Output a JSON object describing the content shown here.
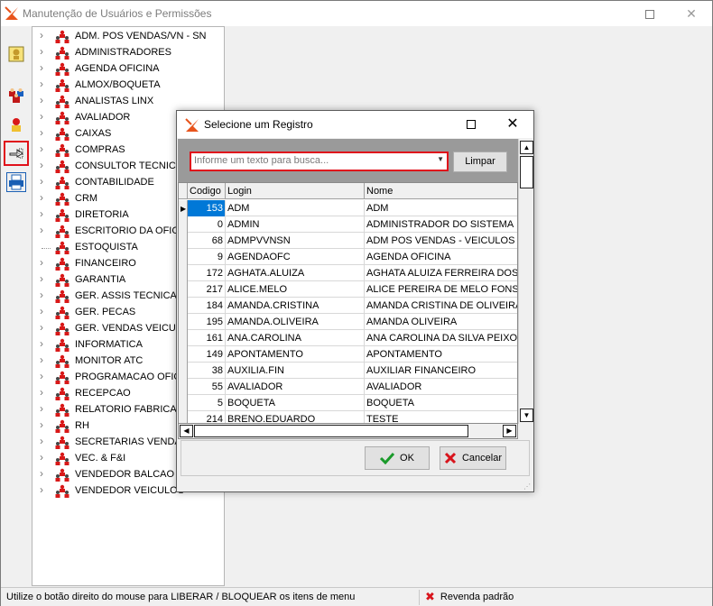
{
  "window": {
    "title": "Manutenção de Usuários e Permissões",
    "maximize_glyph": "",
    "close_glyph": "✕"
  },
  "toolbar": {
    "buttons": [
      {
        "name": "key-user-icon"
      },
      {
        "name": "group-users-icon"
      },
      {
        "name": "user-lock-icon"
      },
      {
        "name": "hand-pointer-icon"
      },
      {
        "name": "print-icon"
      }
    ]
  },
  "tree": {
    "items": [
      {
        "label": "ADM. POS VENDAS/VN - SN",
        "expandable": true
      },
      {
        "label": "ADMINISTRADORES",
        "expandable": true
      },
      {
        "label": "AGENDA OFICINA",
        "expandable": true
      },
      {
        "label": "ALMOX/BOQUETA",
        "expandable": true
      },
      {
        "label": "ANALISTAS LINX",
        "expandable": true
      },
      {
        "label": "AVALIADOR",
        "expandable": true
      },
      {
        "label": "CAIXAS",
        "expandable": true
      },
      {
        "label": "COMPRAS",
        "expandable": true
      },
      {
        "label": "CONSULTOR TECNICO",
        "expandable": true
      },
      {
        "label": "CONTABILIDADE",
        "expandable": true
      },
      {
        "label": "CRM",
        "expandable": true
      },
      {
        "label": "DIRETORIA",
        "expandable": true
      },
      {
        "label": "ESCRITORIO DA OFICIN",
        "expandable": true
      },
      {
        "label": "ESTOQUISTA",
        "expandable": false
      },
      {
        "label": "FINANCEIRO",
        "expandable": true
      },
      {
        "label": "GARANTIA",
        "expandable": true
      },
      {
        "label": "GER. ASSIS TECNICA",
        "expandable": true
      },
      {
        "label": "GER. PECAS",
        "expandable": true
      },
      {
        "label": "GER. VENDAS VEICULOS",
        "expandable": true
      },
      {
        "label": "INFORMATICA",
        "expandable": true
      },
      {
        "label": "MONITOR ATC",
        "expandable": true
      },
      {
        "label": "PROGRAMACAO OFICIN",
        "expandable": true
      },
      {
        "label": "RECEPCAO",
        "expandable": true
      },
      {
        "label": "RELATORIO FABRICA",
        "expandable": true
      },
      {
        "label": "RH",
        "expandable": true
      },
      {
        "label": "SECRETARIAS VENDAS",
        "expandable": true
      },
      {
        "label": "VEC. & F&I",
        "expandable": true
      },
      {
        "label": "VENDEDOR BALCAO PC",
        "expandable": true
      },
      {
        "label": "VENDEDOR VEICULOS",
        "expandable": true
      }
    ]
  },
  "status": {
    "left_text": "Utilize o botão direito do mouse para LIBERAR / BLOQUEAR os itens de menu",
    "right_text": "Revenda padrão",
    "right_icon": "red-x-icon"
  },
  "dialog": {
    "title": "Selecione um Registro",
    "search": {
      "placeholder": "Informe um texto para busca..."
    },
    "clear_label": "Limpar",
    "ok_label": "OK",
    "cancel_label": "Cancelar",
    "columns": [
      "Codigo",
      "Login",
      "Nome"
    ],
    "rows": [
      {
        "codigo": "153",
        "login": "ADM",
        "nome": "ADM",
        "selected": true
      },
      {
        "codigo": "0",
        "login": "ADMIN",
        "nome": "ADMINISTRADOR DO SISTEMA"
      },
      {
        "codigo": "68",
        "login": "ADMPVVNSN",
        "nome": "ADM POS VENDAS - VEICULOS NOV"
      },
      {
        "codigo": "9",
        "login": "AGENDAOFC",
        "nome": "AGENDA OFICINA"
      },
      {
        "codigo": "172",
        "login": "AGHATA.ALUIZA",
        "nome": "AGHATA ALUIZA FERREIRA DOS SA"
      },
      {
        "codigo": "217",
        "login": "ALICE.MELO",
        "nome": "ALICE PEREIRA DE MELO FONSECA"
      },
      {
        "codigo": "184",
        "login": "AMANDA.CRISTINA",
        "nome": "AMANDA CRISTINA DE OLIVEIRA"
      },
      {
        "codigo": "195",
        "login": "AMANDA.OLIVEIRA",
        "nome": "AMANDA OLIVEIRA"
      },
      {
        "codigo": "161",
        "login": "ANA.CAROLINA",
        "nome": "ANA CAROLINA DA SILVA PEIXOTO"
      },
      {
        "codigo": "149",
        "login": "APONTAMENTO",
        "nome": "APONTAMENTO"
      },
      {
        "codigo": "38",
        "login": "AUXILIA.FIN",
        "nome": "AUXILIAR FINANCEIRO"
      },
      {
        "codigo": "55",
        "login": "AVALIADOR",
        "nome": "AVALIADOR"
      },
      {
        "codigo": "5",
        "login": "BOQUETA",
        "nome": "BOQUETA"
      },
      {
        "codigo": "214",
        "login": "BRENO.EDUARDO",
        "nome": "TESTE"
      }
    ]
  },
  "colors": {
    "highlight": "#e0111b",
    "selection": "#0078d7",
    "search_band": "#9a9a9a"
  }
}
